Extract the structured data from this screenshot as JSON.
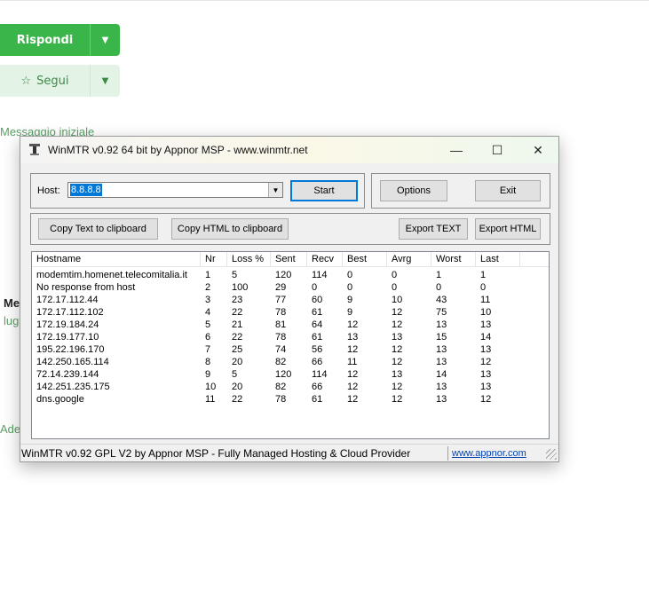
{
  "background": {
    "reply_label": "Rispondi",
    "follow_label": "Segui",
    "initial_message_link": "Messaggio iniziale",
    "partial_bold": "Me",
    "partial_link_1": "lug",
    "partial_link_2": "Ades"
  },
  "window": {
    "title": "WinMTR v0.92 64 bit by Appnor MSP - www.winmtr.net",
    "minimize": "—",
    "maximize": "☐",
    "close": "✕"
  },
  "host": {
    "label": "Host:",
    "value": "8.8.8.8",
    "start_label": "Start",
    "options_label": "Options",
    "exit_label": "Exit"
  },
  "toolbar": {
    "copy_text": "Copy Text to clipboard",
    "copy_html": "Copy HTML to clipboard",
    "export_text": "Export TEXT",
    "export_html": "Export HTML"
  },
  "table": {
    "columns": [
      "Hostname",
      "Nr",
      "Loss %",
      "Sent",
      "Recv",
      "Best",
      "Avrg",
      "Worst",
      "Last"
    ],
    "rows": [
      [
        "modemtim.homenet.telecomitalia.it",
        "1",
        "5",
        "120",
        "114",
        "0",
        "0",
        "1",
        "1"
      ],
      [
        "No response from host",
        "2",
        "100",
        "29",
        "0",
        "0",
        "0",
        "0",
        "0"
      ],
      [
        "172.17.112.44",
        "3",
        "23",
        "77",
        "60",
        "9",
        "10",
        "43",
        "11"
      ],
      [
        "172.17.112.102",
        "4",
        "22",
        "78",
        "61",
        "9",
        "12",
        "75",
        "10"
      ],
      [
        "172.19.184.24",
        "5",
        "21",
        "81",
        "64",
        "12",
        "12",
        "13",
        "13"
      ],
      [
        "172.19.177.10",
        "6",
        "22",
        "78",
        "61",
        "13",
        "13",
        "15",
        "14"
      ],
      [
        "195.22.196.170",
        "7",
        "25",
        "74",
        "56",
        "12",
        "12",
        "13",
        "13"
      ],
      [
        "142.250.165.114",
        "8",
        "20",
        "82",
        "66",
        "11",
        "12",
        "13",
        "12"
      ],
      [
        "72.14.239.144",
        "9",
        "5",
        "120",
        "114",
        "12",
        "13",
        "14",
        "13"
      ],
      [
        "142.251.235.175",
        "10",
        "20",
        "82",
        "66",
        "12",
        "12",
        "13",
        "13"
      ],
      [
        "dns.google",
        "11",
        "22",
        "78",
        "61",
        "12",
        "12",
        "13",
        "12"
      ]
    ]
  },
  "statusbar": {
    "text": "WinMTR v0.92 GPL V2 by Appnor MSP - Fully Managed Hosting & Cloud Provider",
    "link": "www.appnor.com"
  }
}
